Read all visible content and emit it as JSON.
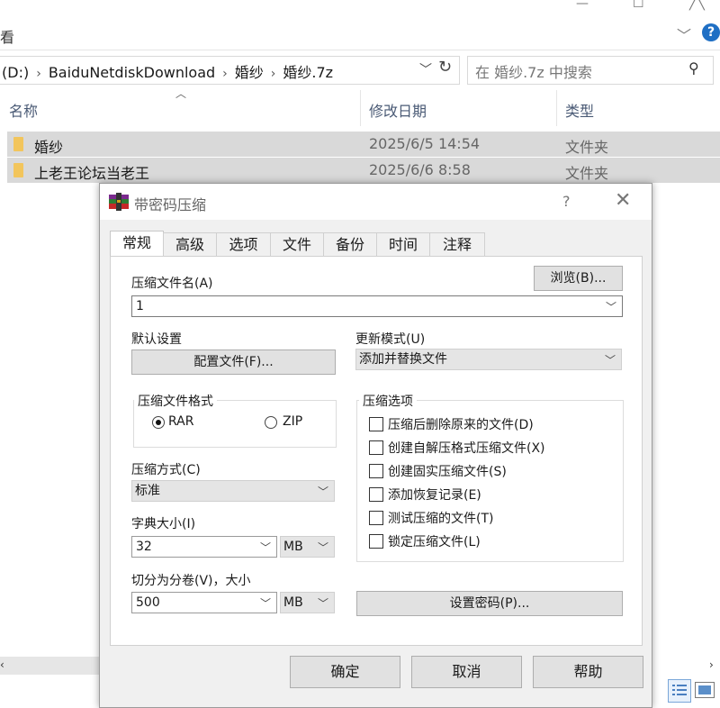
{
  "explorer": {
    "ribbon_edge": "看",
    "address": {
      "segments": [
        "(D:)",
        "BaiduNetdiskDownload",
        "婚纱",
        "婚纱.7z"
      ]
    },
    "search": {
      "placeholder": "在 婚纱.7z 中搜索"
    },
    "columns": {
      "name": "名称",
      "date": "修改日期",
      "type": "类型"
    },
    "files": [
      {
        "name": "婚纱",
        "date": "2025/6/5 14:54",
        "type": "文件夹"
      },
      {
        "name": "上老王论坛当老王",
        "date": "2025/6/6 8:58",
        "type": "文件夹"
      }
    ]
  },
  "dialog": {
    "title": "带密码压缩",
    "help": "?",
    "tabs": [
      "常规",
      "高级",
      "选项",
      "文件",
      "备份",
      "时间",
      "注释"
    ],
    "archive_name_label": "压缩文件名(A)",
    "browse_button": "浏览(B)...",
    "archive_name_value": "1",
    "default_settings_label": "默认设置",
    "profiles_button": "配置文件(F)...",
    "update_mode_label": "更新模式(U)",
    "update_mode_value": "添加并替换文件",
    "format_group": "压缩文件格式",
    "format_rar": "RAR",
    "format_zip": "ZIP",
    "method_label": "压缩方式(C)",
    "method_value": "标准",
    "dict_label": "字典大小(I)",
    "dict_value": "32",
    "dict_unit": "MB",
    "split_label": "切分为分卷(V)，大小",
    "split_value": "500",
    "split_unit": "MB",
    "options_group": "压缩选项",
    "options": [
      "压缩后删除原来的文件(D)",
      "创建自解压格式压缩文件(X)",
      "创建固实压缩文件(S)",
      "添加恢复记录(E)",
      "测试压缩的文件(T)",
      "锁定压缩文件(L)"
    ],
    "set_password_button": "设置密码(P)...",
    "ok_button": "确定",
    "cancel_button": "取消",
    "help_button": "帮助"
  },
  "colors": {
    "accent": "#1f6fc4",
    "selection": "#d9d9d9",
    "folder": "#f2c55c"
  }
}
